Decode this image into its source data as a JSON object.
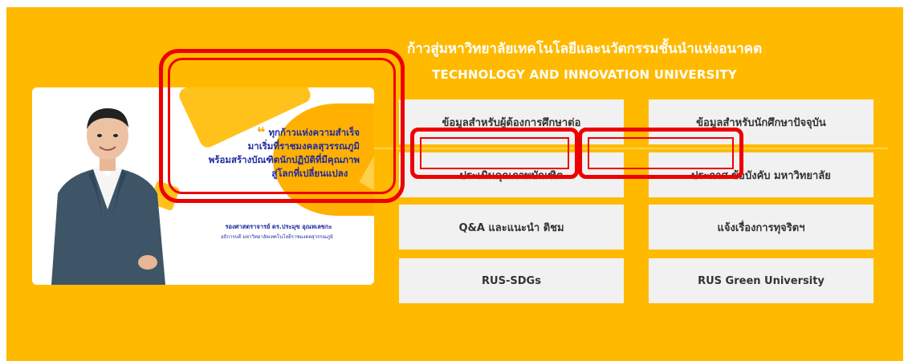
{
  "header": {
    "title_th": "ก้าวสู่มหาวิทยาลัยเทคโนโลยีและนวัตกรรมชั้นนำแห่งอนาคต",
    "title_en": "TECHNOLOGY AND INNOVATION UNIVERSITY"
  },
  "banner": {
    "quote_lines": [
      "ทุกก้าวแห่งความสำเร็จ",
      "มาเริ่มที่ราชมงคลสุวรรณภูมิ",
      "พร้อมสร้างบัณฑิตนักปฏิบัติที่มีคุณภาพ",
      "สู่โลกที่เปลี่ยนแปลง"
    ],
    "open_quote": "❝",
    "close_quote": "❞",
    "signature_name": "รองศาสตราจารย์ ดร.ประมุข อุณหเลขกะ",
    "signature_title": "อธิการบดี มหาวิทยาลัยเทคโนโลยีราชมงคลสุวรรณภูมิ"
  },
  "links": [
    {
      "label": "ข้อมูลสำหรับผู้ต้องการศึกษาต่อ"
    },
    {
      "label": "ข้อมูลสำหรับนักศึกษาปัจจุบัน"
    },
    {
      "label": "ประเมินคุณภาพบัณฑิต"
    },
    {
      "label": "ประกาศ ข้อบังคับ มหาวิทยาลัย"
    },
    {
      "label": "Q&A และแนะนำ ติชม"
    },
    {
      "label": "แจ้งเรื่องการทุจริตฯ"
    },
    {
      "label": "RUS-SDGs"
    },
    {
      "label": "RUS Green University"
    }
  ],
  "colors": {
    "background": "#FFBA00",
    "button_bg": "#F1F1F1",
    "highlight": "#EE0000",
    "quote_text": "#1F2A9E"
  }
}
